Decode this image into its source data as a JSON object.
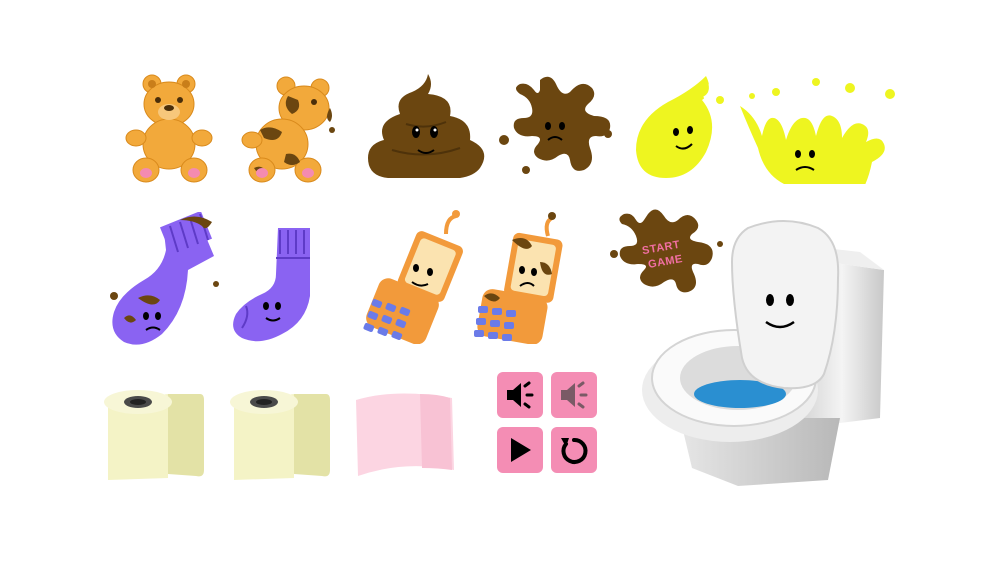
{
  "sprite_sheet": {
    "sprites": [
      {
        "name": "teddy-bear-clean-sprite",
        "color": "#F2A93B"
      },
      {
        "name": "teddy-bear-dirty-sprite",
        "color": "#F2A93B"
      },
      {
        "name": "poop-sprite",
        "color": "#6B4610"
      },
      {
        "name": "poop-splat-sprite",
        "color": "#6B4610"
      },
      {
        "name": "pee-drop-sprite",
        "color": "#EEF520"
      },
      {
        "name": "pee-splash-sprite",
        "color": "#EEF520"
      },
      {
        "name": "sock-dirty-sprite",
        "color": "#8A63F2"
      },
      {
        "name": "sock-clean-sprite",
        "color": "#8A63F2"
      },
      {
        "name": "phone-clean-sprite",
        "color": "#F29A3B"
      },
      {
        "name": "phone-dirty-sprite",
        "color": "#F29A3B"
      },
      {
        "name": "toilet-paper-roll-sprite",
        "color": "#F4F3C6"
      },
      {
        "name": "toilet-paper-roll-alt-sprite",
        "color": "#F4F3C6"
      },
      {
        "name": "pink-paper-sprite",
        "color": "#FCD5E2"
      },
      {
        "name": "toilet-sprite",
        "color": "#E8E8E8"
      }
    ]
  },
  "start_button": {
    "line1": "START",
    "line2": "GAME",
    "text_color": "#F26FA3",
    "splat_color": "#6B4610"
  },
  "control_buttons": [
    {
      "name": "sound-on-button",
      "icon": "speaker-icon"
    },
    {
      "name": "sound-off-button",
      "icon": "speaker-muted-icon"
    },
    {
      "name": "play-button",
      "icon": "play-icon"
    },
    {
      "name": "restart-button",
      "icon": "restart-icon"
    }
  ],
  "colors": {
    "button_bg": "#F48DB4",
    "button_icon": "#000000",
    "button_icon_muted": "#7A5A66",
    "water": "#2A8FD1"
  }
}
